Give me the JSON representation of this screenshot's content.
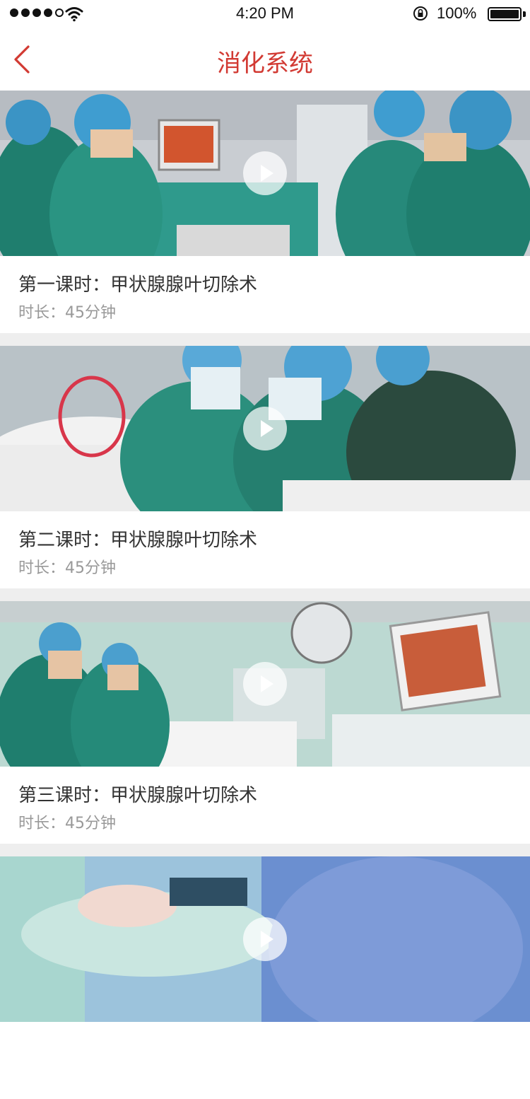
{
  "status_bar": {
    "time": "4:20 PM",
    "battery_percent": "100%",
    "signal_icon": "signal-dots-icon",
    "wifi_icon": "wifi-icon",
    "lock_icon": "rotation-lock-icon",
    "battery_icon": "battery-icon"
  },
  "header": {
    "title": "消化系统",
    "back_icon": "chevron-left-icon",
    "accent_color": "#d23a33"
  },
  "lessons": [
    {
      "title": "第一课时：甲状腺腺叶切除术",
      "duration": "时长：45分钟",
      "scene": "operating-room-monitor"
    },
    {
      "title": "第二课时：甲状腺腺叶切除术",
      "duration": "时长：45分钟",
      "scene": "surgeons-closeup"
    },
    {
      "title": "第三课时：甲状腺腺叶切除术",
      "duration": "时长：45分钟",
      "scene": "laparoscopy-monitor"
    },
    {
      "title": "",
      "duration": "",
      "scene": "surgery-blue-drapes"
    }
  ]
}
